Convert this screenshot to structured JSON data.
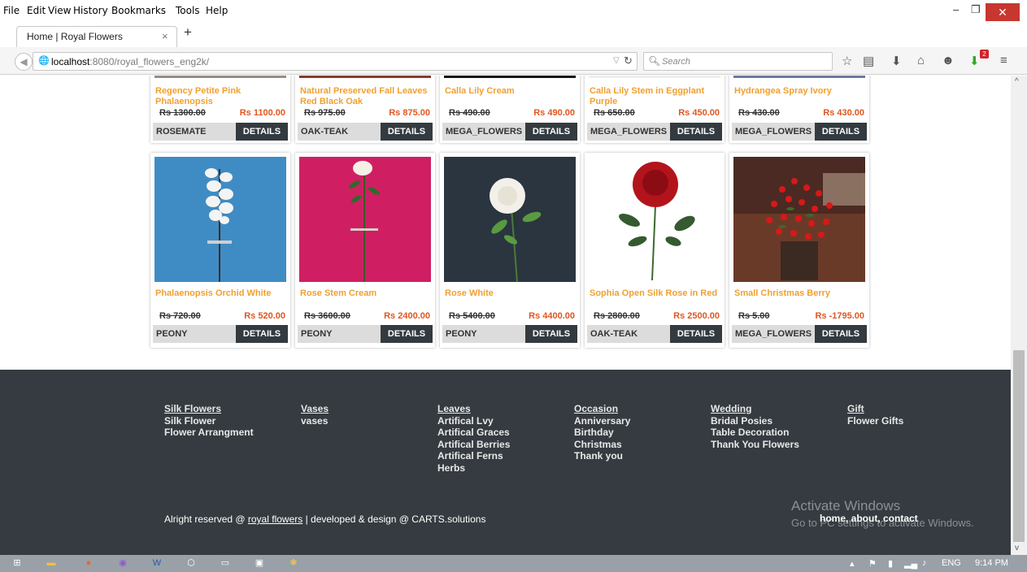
{
  "menubar": {
    "items": [
      "File",
      "Edit",
      "View",
      "History",
      "Bookmarks",
      "Tools",
      "Help"
    ]
  },
  "tab": {
    "title": "Home | Royal Flowers",
    "close": "×",
    "new": "+"
  },
  "nav": {
    "host": "localhost",
    "path": ":8080/royal_flowers_eng2k/",
    "search_placeholder": "Search",
    "download_badge": "2"
  },
  "products_top": [
    {
      "name": "Regency Petite Pink Phalaenopsis",
      "old": "Rs 1300.00",
      "new": "Rs 1100.00",
      "brand": "ROSEMATE",
      "btn": "DETAILS"
    },
    {
      "name": "Natural Preserved Fall Leaves Red Black Oak",
      "old": "Rs 975.00",
      "new": "Rs 875.00",
      "brand": "OAK-TEAK",
      "btn": "DETAILS"
    },
    {
      "name": "Calla Lily Cream",
      "old": "Rs 490.00",
      "new": "Rs 490.00",
      "brand": "MEGA_FLOWERS",
      "btn": "DETAILS"
    },
    {
      "name": "Calla Lily Stem in Eggplant Purple",
      "old": "Rs 650.00",
      "new": "Rs 450.00",
      "brand": "MEGA_FLOWERS",
      "btn": "DETAILS"
    },
    {
      "name": "Hydrangea Spray Ivory",
      "old": "Rs 430.00",
      "new": "Rs 430.00",
      "brand": "MEGA_FLOWERS",
      "btn": "DETAILS"
    }
  ],
  "products_bottom": [
    {
      "name": "Phalaenopsis Orchid White",
      "old": "Rs 720.00",
      "new": "Rs 520.00",
      "brand": "PEONY",
      "btn": "DETAILS"
    },
    {
      "name": "Rose Stem Cream",
      "old": "Rs 3600.00",
      "new": "Rs 2400.00",
      "brand": "PEONY",
      "btn": "DETAILS"
    },
    {
      "name": "Rose White",
      "old": "Rs 5400.00",
      "new": "Rs 4400.00",
      "brand": "PEONY",
      "btn": "DETAILS"
    },
    {
      "name": "Sophia Open Silk Rose in Red",
      "old": "Rs 2800.00",
      "new": "Rs 2500.00",
      "brand": "OAK-TEAK",
      "btn": "DETAILS"
    },
    {
      "name": "Small Christmas Berry",
      "old": "Rs 5.00",
      "new": "Rs -1795.00",
      "brand": "MEGA_FLOWERS",
      "btn": "DETAILS"
    }
  ],
  "footer": {
    "columns": [
      {
        "head": "Silk Flowers",
        "items": [
          "Silk Flower",
          "Flower Arrangment"
        ]
      },
      {
        "head": "Vases",
        "items": [
          "vases"
        ]
      },
      {
        "head": "Leaves",
        "items": [
          "Artifical Lvy",
          "Artifical Graces",
          "Artifical Berries",
          "Artifical Ferns",
          "Herbs"
        ]
      },
      {
        "head": "Occasion",
        "items": [
          "Anniversary",
          "Birthday",
          "Christmas",
          "Thank you"
        ]
      },
      {
        "head": "Wedding",
        "items": [
          "Bridal Posies",
          "Table Decoration",
          "Thank You Flowers"
        ]
      },
      {
        "head": "Gift",
        "items": [
          "Flower Gifts"
        ]
      }
    ],
    "copyright_pre": "Alright reserved @ ",
    "copyright_link": "royal flowers",
    "copyright_post": " | developed & design @ CARTS.solutions",
    "links": "home, about, contact",
    "activate_title": "Activate Windows",
    "activate_sub": "Go to PC settings to activate Windows."
  },
  "taskbar": {
    "lang": "ENG",
    "time": "9:14 PM"
  }
}
